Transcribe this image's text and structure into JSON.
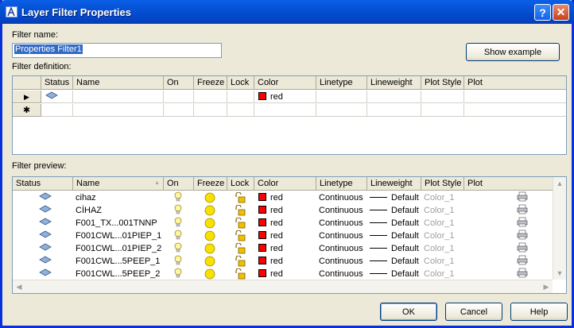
{
  "window": {
    "title": "Layer Filter Properties"
  },
  "filter_name": {
    "label": "Filter name:",
    "value": "Properties Filter1"
  },
  "show_example_label": "Show example",
  "definition": {
    "label": "Filter definition:",
    "columns": [
      "Status",
      "Name",
      "On",
      "Freeze",
      "Lock",
      "Color",
      "Linetype",
      "Lineweight",
      "Plot Style",
      "Plot"
    ],
    "current_row_marker": "▶",
    "new_row_marker": "✱",
    "row_color": "red"
  },
  "preview": {
    "label": "Filter preview:",
    "columns": [
      "Status",
      "Name",
      "On",
      "Freeze",
      "Lock",
      "Color",
      "Linetype",
      "Lineweight",
      "Plot Style",
      "Plot"
    ],
    "sort_indicator": "▲",
    "rows": [
      {
        "name": "cihaz",
        "color": "red",
        "linetype": "Continuous",
        "lineweight": "Default",
        "plot_style": "Color_1"
      },
      {
        "name": "CİHAZ",
        "color": "red",
        "linetype": "Continuous",
        "lineweight": "Default",
        "plot_style": "Color_1"
      },
      {
        "name": "F001_TX...001TNNP",
        "color": "red",
        "linetype": "Continuous",
        "lineweight": "Default",
        "plot_style": "Color_1"
      },
      {
        "name": "F001CWL...01PIEP_1",
        "color": "red",
        "linetype": "Continuous",
        "lineweight": "Default",
        "plot_style": "Color_1"
      },
      {
        "name": "F001CWL...01PIEP_2",
        "color": "red",
        "linetype": "Continuous",
        "lineweight": "Default",
        "plot_style": "Color_1"
      },
      {
        "name": "F001CWL...5PEEP_1",
        "color": "red",
        "linetype": "Continuous",
        "lineweight": "Default",
        "plot_style": "Color_1"
      },
      {
        "name": "F001CWL...5PEEP_2",
        "color": "red",
        "linetype": "Continuous",
        "lineweight": "Default",
        "plot_style": "Color_1"
      }
    ]
  },
  "buttons": {
    "ok": "OK",
    "cancel": "Cancel",
    "help": "Help"
  },
  "colors": {
    "layer_color": "#ff0000",
    "title_bar": "#0654d6",
    "selection": "#316ac5"
  },
  "icons": [
    "app-icon",
    "help-icon",
    "close-icon",
    "layer-status-icon",
    "lightbulb-on-icon",
    "sun-thawed-icon",
    "padlock-unlocked-icon",
    "printer-icon"
  ]
}
